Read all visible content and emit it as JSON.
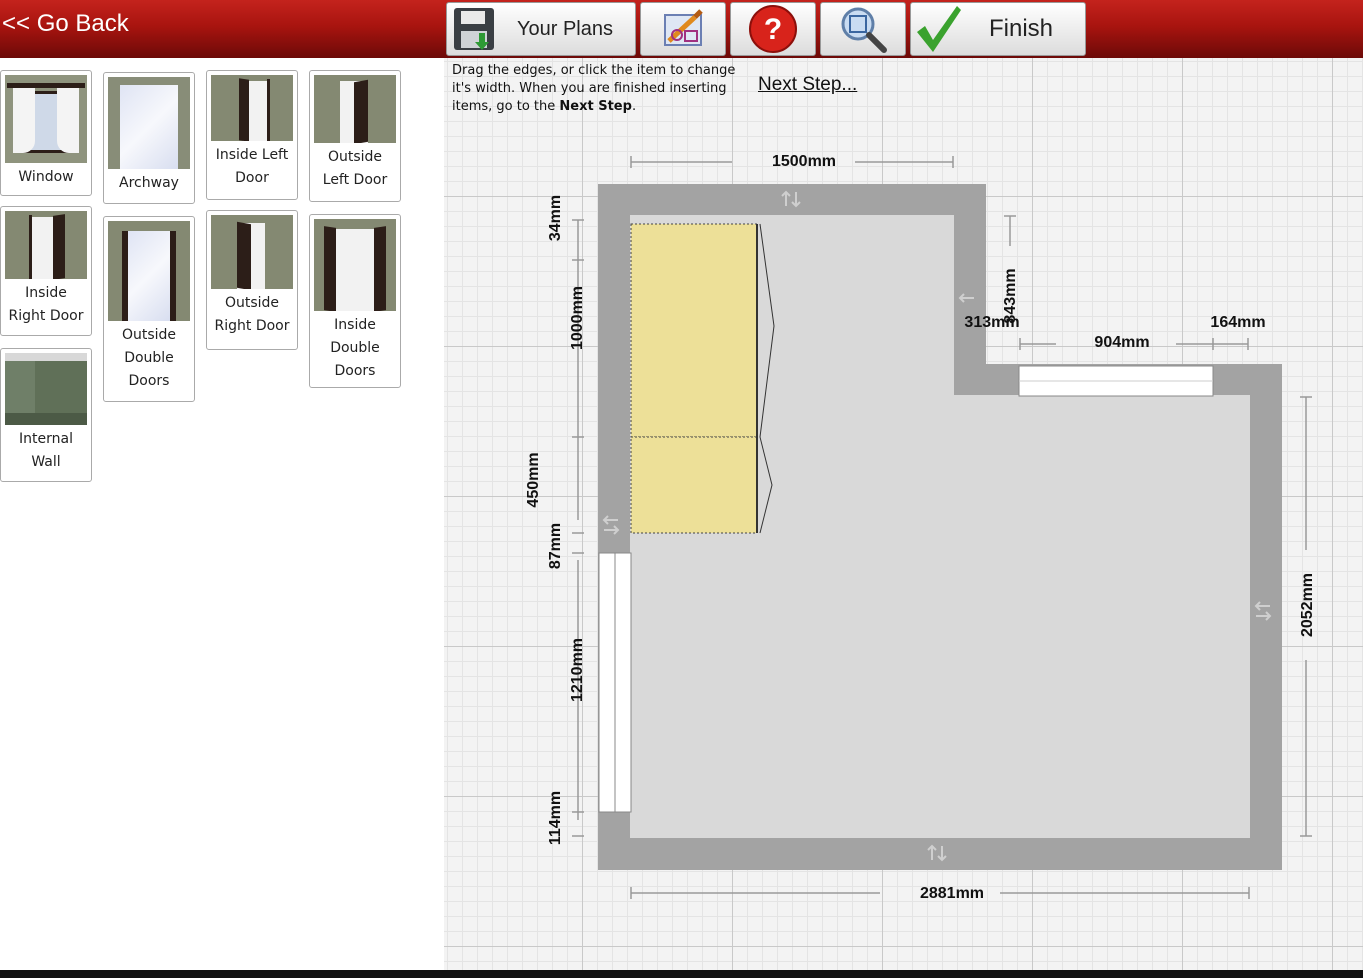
{
  "header": {
    "go_back": "<< Go Back"
  },
  "toolbar": {
    "your_plans": "Your Plans",
    "finish": "Finish"
  },
  "sidebar": {
    "items": [
      {
        "line1": "Window",
        "line2": ""
      },
      {
        "line1": "Archway",
        "line2": ""
      },
      {
        "line1": "Inside Left",
        "line2": "Door"
      },
      {
        "line1": "Outside",
        "line2": "Left Door"
      },
      {
        "line1": "Inside",
        "line2": "Right Door"
      },
      {
        "line1": "Outside",
        "line2": "Double",
        "line3": "Doors"
      },
      {
        "line1": "Outside",
        "line2": "Right Door"
      },
      {
        "line1": "Inside",
        "line2": "Double",
        "line3": "Doors"
      },
      {
        "line1": "Internal",
        "line2": "Wall"
      }
    ]
  },
  "instructions": {
    "text_a": "Drag the edges, or click the item to change it's width. When you are finished inserting items, go to the ",
    "bold": "Next Step",
    "text_b": ".",
    "next_step": "Next Step..."
  },
  "dimensions": {
    "top": "1500mm",
    "bottom": "2881mm",
    "right": "2052mm",
    "left_34": "34mm",
    "left_1000": "1000mm",
    "left_450": "450mm",
    "left_87": "87mm",
    "left_1210": "1210mm",
    "left_114": "114mm",
    "notch_313": "313mm",
    "notch_843": "843mm",
    "door_904": "904mm",
    "right_164": "164mm"
  }
}
